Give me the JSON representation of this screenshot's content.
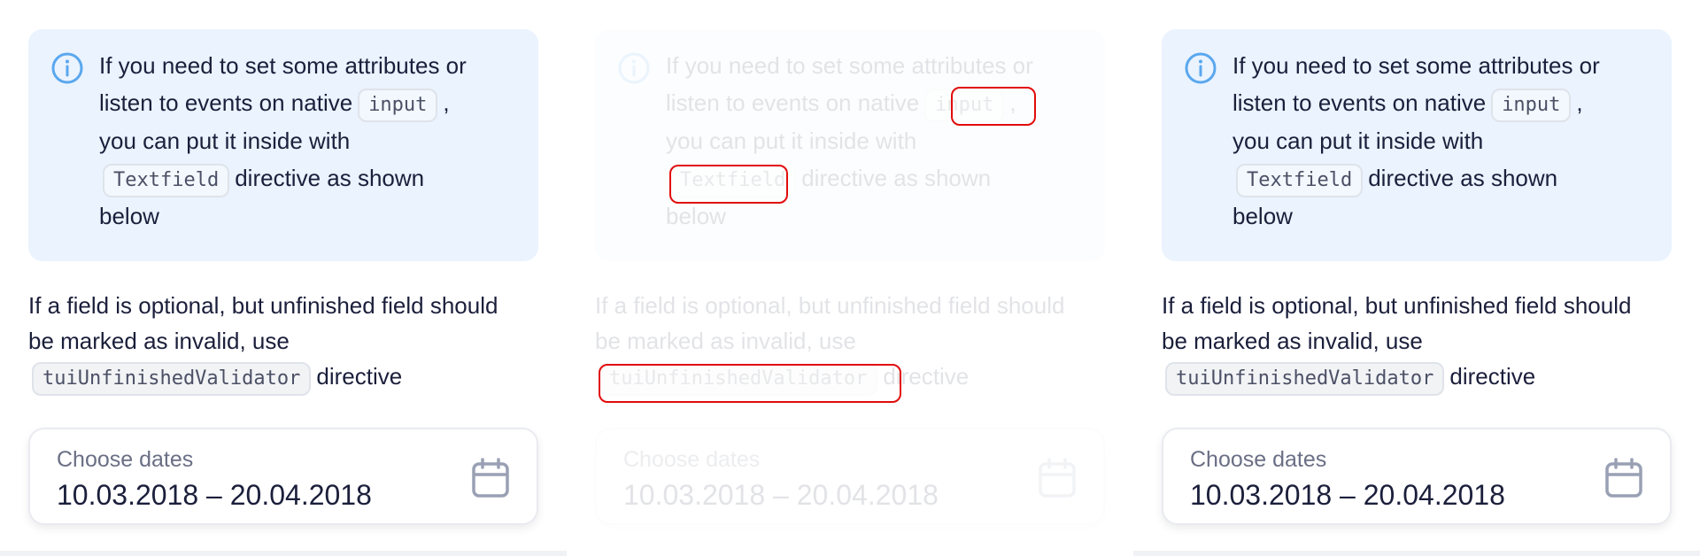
{
  "panels": [
    {
      "id": "expected",
      "notice": {
        "line1": "If you need to set some attributes or",
        "line2_prefix": "listen to events on native",
        "code_input": "input",
        "line2_suffix": ",",
        "line3": "you can put it inside with",
        "code_textfield": "Textfield",
        "line4_suffix": "directive as shown",
        "line5": "below"
      },
      "paragraph": {
        "line1": "If a field is optional, but unfinished field should",
        "line2": "be marked as invalid, use",
        "code": "tuiUnfinishedValidator",
        "suffix": "directive"
      },
      "date_field": {
        "label": "Choose dates",
        "value": "10.03.2018 – 20.04.2018"
      }
    },
    {
      "id": "diff",
      "notice": {
        "line1": "If you need to set some attributes or",
        "line2_prefix": "listen to events on native",
        "code_input": "input",
        "line2_suffix": ",",
        "line3": "you can put it inside with",
        "code_textfield": "Textfield",
        "line4_suffix": "directive as shown",
        "line5": "below"
      },
      "paragraph": {
        "line1": "If a field is optional, but unfinished field should",
        "line2": "be marked as invalid, use",
        "code": "tuiUnfinishedValidator",
        "suffix": "directive"
      },
      "date_field": {
        "label": "Choose dates",
        "value": "10.03.2018 – 20.04.2018"
      }
    },
    {
      "id": "actual",
      "notice": {
        "line1": "If you need to set some attributes or",
        "line2_prefix": "listen to events on native",
        "code_input": "input",
        "line2_suffix": ",",
        "line3": "you can put it inside with",
        "code_textfield": "Textfield",
        "line4_suffix": "directive as shown",
        "line5": "below"
      },
      "paragraph": {
        "line1": "If a field is optional, but unfinished field should",
        "line2": "be marked as invalid, use",
        "code": "tuiUnfinishedValidator",
        "suffix": "directive"
      },
      "date_field": {
        "label": "Choose dates",
        "value": "10.03.2018 – 20.04.2018"
      }
    }
  ],
  "colors": {
    "notice_bg": "#eaf3fe",
    "info_icon": "#5aa7ee",
    "diff_highlight": "#e20c0c",
    "text": "#1b1f3b"
  },
  "icons": [
    "info-icon",
    "calendar-icon"
  ]
}
